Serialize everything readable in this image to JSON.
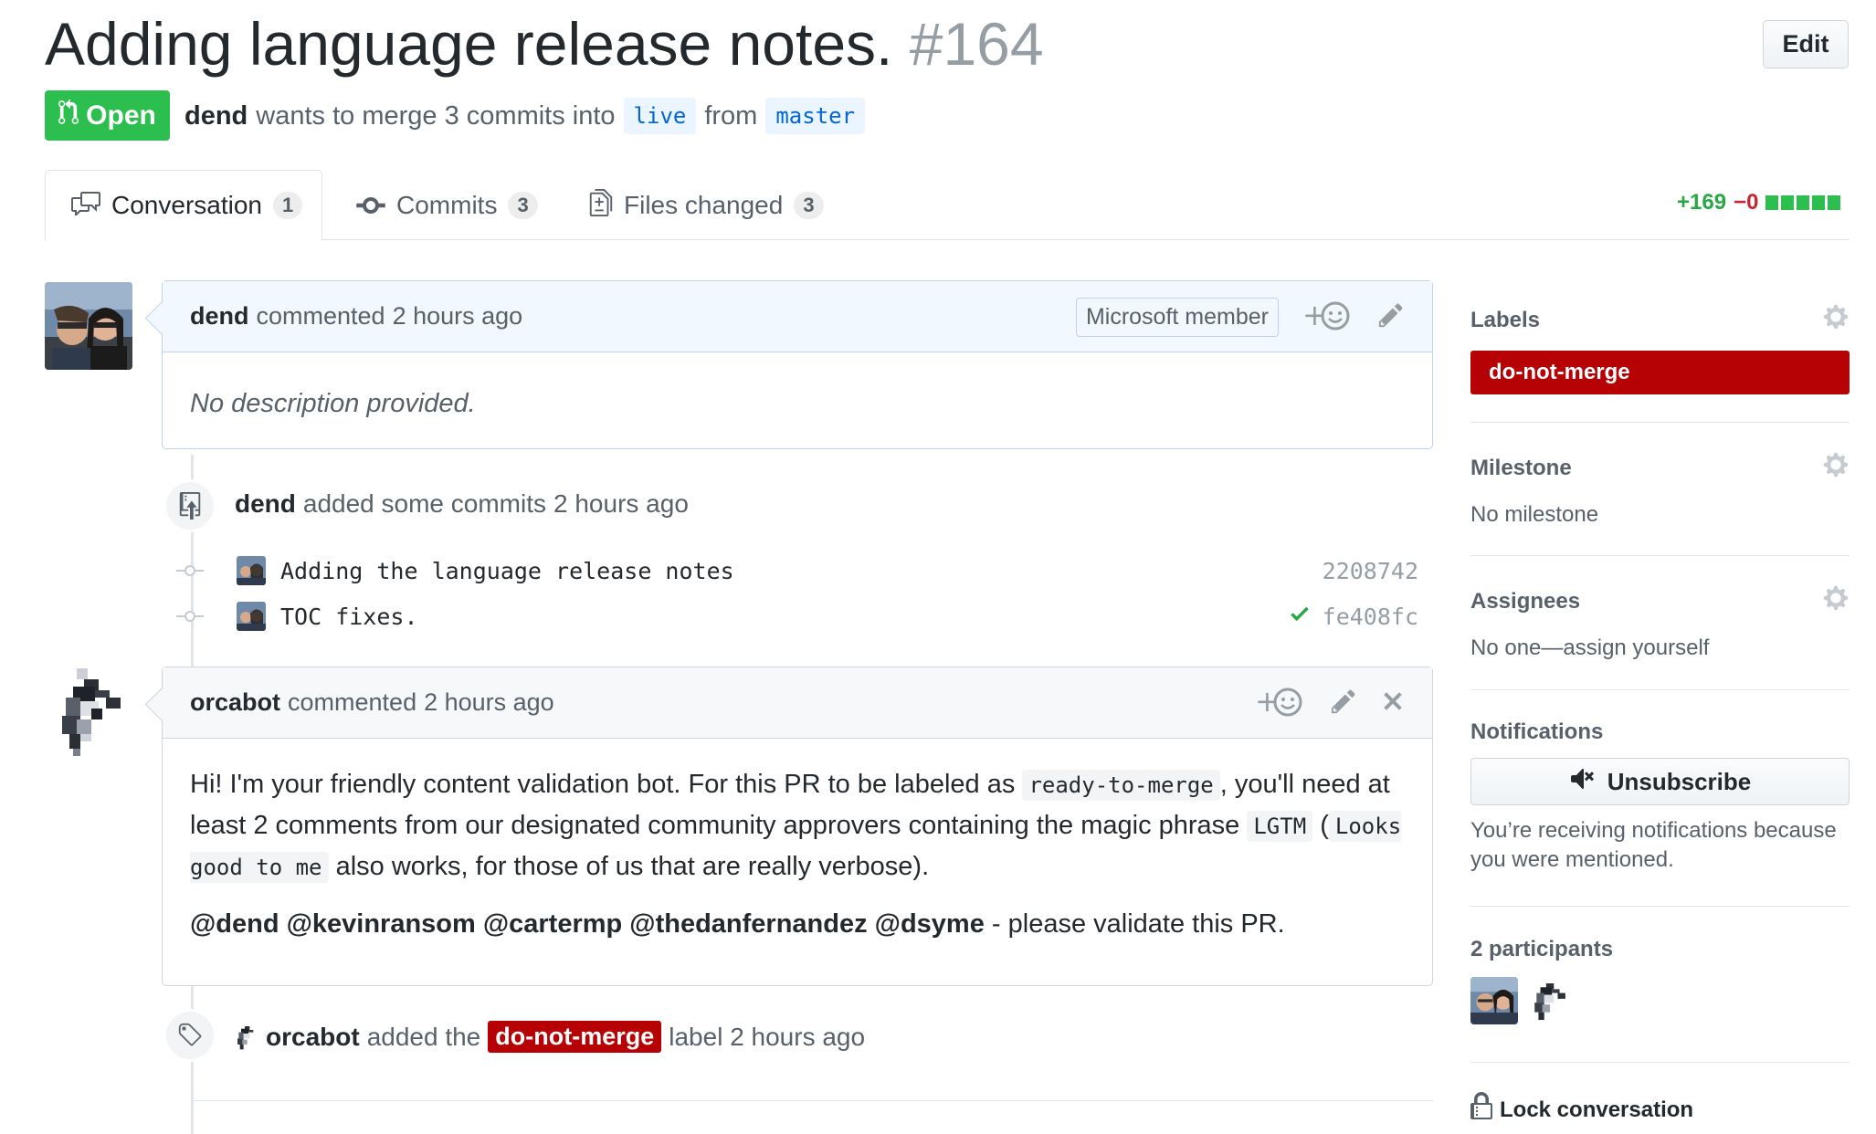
{
  "pr": {
    "title": "Adding language release notes.",
    "number": "#164",
    "edit_label": "Edit",
    "state_label": "Open",
    "author": "dend",
    "merge_text": "wants to merge 3 commits into",
    "base_branch": "live",
    "from_text": "from",
    "head_branch": "master"
  },
  "tabs": [
    {
      "label": "Conversation",
      "count": "1"
    },
    {
      "label": "Commits",
      "count": "3"
    },
    {
      "label": "Files changed",
      "count": "3"
    }
  ],
  "diffstat": {
    "additions": "+169",
    "deletions": "−0"
  },
  "comment1": {
    "author": "dend",
    "action": "commented",
    "time": "2 hours ago",
    "badge": "Microsoft member",
    "body": "No description provided."
  },
  "commits_event": {
    "author": "dend",
    "text": "added some commits",
    "time": "2 hours ago",
    "commits": [
      {
        "message": "Adding the language release notes",
        "sha": "2208742"
      },
      {
        "message": "TOC fixes.",
        "sha": "fe408fc"
      }
    ]
  },
  "comment2": {
    "author": "orcabot",
    "action": "commented",
    "time": "2 hours ago",
    "p1_a": "Hi! I'm your friendly content validation bot. For this PR to be labeled as",
    "code1": "ready-to-merge",
    "p1_b": ", you'll need at least 2 comments from our designated community approvers containing the magic phrase",
    "code2": "LGTM",
    "p1_c": "(",
    "code3": "Looks good to me",
    "p1_d": "also works, for those of us that are really verbose).",
    "mentions": "@dend @kevinransom @cartermp @thedanfernandez @dsyme",
    "p2_tail": "- please validate this PR."
  },
  "label_event": {
    "author": "orcabot",
    "text_before": "added the",
    "label": "do-not-merge",
    "text_after": "label 2 hours ago"
  },
  "sidebar": {
    "labels_heading": "Labels",
    "label": "do-not-merge",
    "milestone_heading": "Milestone",
    "milestone_value": "No milestone",
    "assignees_heading": "Assignees",
    "assignees_value": "No one—assign yourself",
    "notifications_heading": "Notifications",
    "unsubscribe_label": "Unsubscribe",
    "notifications_reason": "You’re receiving notifications because you were mentioned.",
    "participants_heading": "2 participants",
    "lock_label": "Lock conversation"
  },
  "colors": {
    "open_green": "#2cbe4e",
    "label_red": "#b60205",
    "link_blue": "#0366d6"
  }
}
